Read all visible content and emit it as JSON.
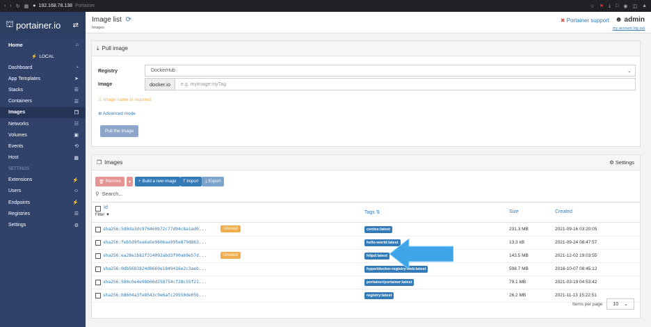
{
  "browser": {
    "ip": "192.168.78.138",
    "tab_title": "Portainer"
  },
  "logo": "portainer.io",
  "sidebar": {
    "home": "Home",
    "endpoint": "LOCAL",
    "items": [
      {
        "label": "Dashboard",
        "icon": "dashboard-icon"
      },
      {
        "label": "App Templates",
        "icon": "rocket-icon"
      },
      {
        "label": "Stacks",
        "icon": "list-icon"
      },
      {
        "label": "Containers",
        "icon": "server-icon"
      },
      {
        "label": "Images",
        "icon": "clone-icon"
      },
      {
        "label": "Networks",
        "icon": "sitemap-icon"
      },
      {
        "label": "Volumes",
        "icon": "cubes-icon"
      },
      {
        "label": "Events",
        "icon": "history-icon"
      },
      {
        "label": "Host",
        "icon": "th-icon"
      }
    ],
    "settings_label": "SETTINGS",
    "settings_items": [
      {
        "label": "Extensions",
        "icon": "bolt-icon"
      },
      {
        "label": "Users",
        "icon": "users-icon"
      },
      {
        "label": "Endpoints",
        "icon": "plug-icon"
      },
      {
        "label": "Registries",
        "icon": "database-icon"
      },
      {
        "label": "Settings",
        "icon": "cogs-icon"
      }
    ]
  },
  "header": {
    "title": "Image list",
    "breadcrumb": "Images",
    "support": "Portainer support",
    "user": "admin",
    "my_account": "my account",
    "log_out": "log out"
  },
  "pull": {
    "title": "Pull image",
    "registry_label": "Registry",
    "registry_value": "DockerHub",
    "image_label": "Image",
    "image_prefix": "docker.io",
    "image_placeholder": "e.g. myImage:myTag",
    "warning": "Image name is required.",
    "advanced": "Advanced mode",
    "button": "Pull the image"
  },
  "images": {
    "title": "Images",
    "settings": "Settings",
    "remove": "Remove",
    "build": "Build a new image",
    "import": "Import",
    "export": "Export",
    "search_placeholder": "Search...",
    "col_id": "Id",
    "col_filter": "Filter",
    "col_tags": "Tags",
    "col_size": "Size",
    "col_created": "Created",
    "unused_label": "Unused",
    "rows": [
      {
        "id": "sha256:5d0da3dc976460b72c77d94c8a1ad0...",
        "unused": true,
        "tag": "centos:latest",
        "size": "231.3 MB",
        "created": "2021-09-16 03:20:05"
      },
      {
        "id": "sha256:feb5d9fea6a5e9606aa995e879d862...",
        "unused": false,
        "tag": "hello-world:latest",
        "size": "13.3 kB",
        "created": "2021-09-24 08:47:57"
      },
      {
        "id": "sha256:ea28e1b82f314092abd3f90a69e57d...",
        "unused": true,
        "tag": "httpd:latest",
        "size": "143.5 MB",
        "created": "2021-12-02 19:03:55"
      },
      {
        "id": "sha256:0db5683824d8669e1849416e2c3aeb...",
        "unused": false,
        "tag": "hyper/docker-registry-web:latest",
        "size": "598.7 MB",
        "created": "2016-10-07 08:45:12"
      },
      {
        "id": "sha256:580c0e4e98b06d258754cf28c55f21...",
        "unused": false,
        "tag": "portainer/portainer:latest",
        "size": "79.1 MB",
        "created": "2021-03-19 04:53:42"
      },
      {
        "id": "sha256:b8604a3fe8543c9e6afc29550de05b...",
        "unused": false,
        "tag": "registry:latest",
        "size": "26.2 MB",
        "created": "2021-11-13 15:22:51"
      }
    ],
    "items_per_page_label": "Items per page",
    "items_per_page": "10"
  }
}
